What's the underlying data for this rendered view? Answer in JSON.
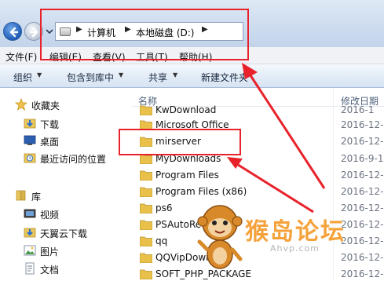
{
  "address": {
    "crumbs": [
      "计算机",
      "本地磁盘 (D:)"
    ],
    "arrow_glyph": "▶"
  },
  "menu": {
    "items": [
      "文件(F)",
      "编辑(E)",
      "查看(V)",
      "工具(T)",
      "帮助(H)"
    ]
  },
  "toolbar": {
    "organize": "组织",
    "include_in_library": "包含到库中",
    "share": "共享",
    "new_folder": "新建文件夹",
    "caret": "▼"
  },
  "nav": {
    "favorites": "收藏夹",
    "favorites_items": [
      "下载",
      "桌面",
      "最近访问的位置"
    ],
    "libraries": "库",
    "library_items": [
      "视频",
      "天翼云下载",
      "图片",
      "文档"
    ]
  },
  "columns": {
    "name": "名称",
    "modified": "修改日期"
  },
  "files": [
    {
      "name": "KwDownload",
      "date": "2016-1"
    },
    {
      "name": "Microsoft Office",
      "date": "2016-12-"
    },
    {
      "name": "mirserver",
      "date": "2016-12-"
    },
    {
      "name": "MyDownloads",
      "date": "2016-9-1"
    },
    {
      "name": "Program Files",
      "date": "2016-12-"
    },
    {
      "name": "Program Files (x86)",
      "date": "2016-12-"
    },
    {
      "name": "ps6",
      "date": "2016-12-"
    },
    {
      "name": "PSAutoRe",
      "date": "2016-12-"
    },
    {
      "name": "qq",
      "date": "2016-12-"
    },
    {
      "name": "QQVipDownload",
      "date": "2016-12-"
    },
    {
      "name": "SOFT_PHP_PACKAGE",
      "date": "2016-12-"
    }
  ],
  "watermark": {
    "title": "猴岛论坛",
    "url": "Ahvp.com"
  },
  "colors": {
    "highlight_red": "#e8222a",
    "folder_yellow": "#e8c04a"
  }
}
